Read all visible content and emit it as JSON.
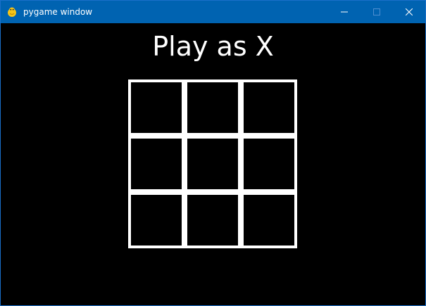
{
  "window": {
    "title": "pygame window",
    "icon": "pygame-snake-icon",
    "controls": [
      "minimize-icon",
      "maximize-icon",
      "close-icon"
    ]
  },
  "game": {
    "heading": "Play as X",
    "board": [
      [
        "",
        "",
        ""
      ],
      [
        "",
        "",
        ""
      ],
      [
        "",
        "",
        ""
      ]
    ]
  },
  "colors": {
    "titlebar": "#0063b1",
    "background": "#000000",
    "grid": "#ffffff",
    "text": "#ffffff"
  }
}
